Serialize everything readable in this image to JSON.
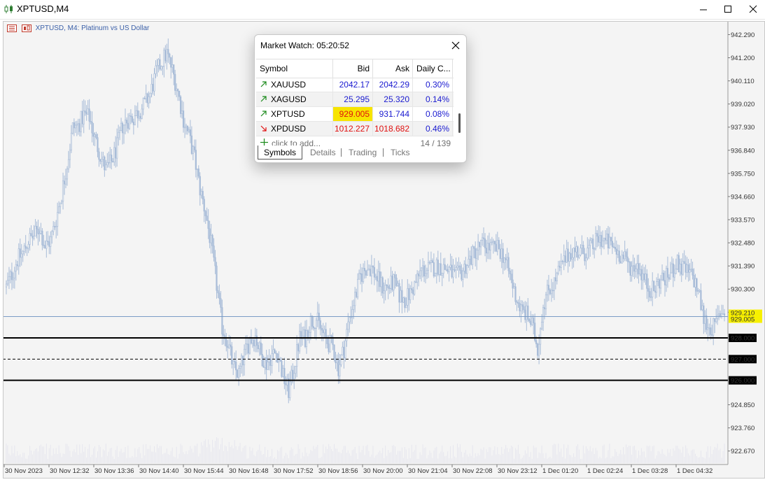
{
  "window": {
    "title": "XPTUSD,M4",
    "app_icon": "candlestick-chart-icon",
    "buttons": [
      "minimize-icon",
      "maximize-icon",
      "close-icon"
    ]
  },
  "chart": {
    "header": "XPTUSD, M4:  Platinum vs US Dollar",
    "price_ticks": [
      "942.290",
      "941.200",
      "940.110",
      "939.020",
      "937.930",
      "936.840",
      "935.750",
      "934.660",
      "933.570",
      "932.480",
      "931.390",
      "930.300",
      "929.210",
      "928.000",
      "927.000",
      "926.000",
      "924.850",
      "923.760",
      "922.670"
    ],
    "time_ticks": [
      "30 Nov 2023",
      "30 Nov 12:32",
      "30 Nov 13:36",
      "30 Nov 14:40",
      "30 Nov 15:44",
      "30 Nov 16:48",
      "30 Nov 17:52",
      "30 Nov 18:56",
      "30 Nov 20:00",
      "30 Nov 21:04",
      "30 Nov 22:08",
      "30 Nov 23:12",
      "1 Dec 01:20",
      "1 Dec 02:24",
      "1 Dec 03:28",
      "1 Dec 04:32"
    ],
    "current_price_label": "929.005",
    "level_lines": [
      {
        "price": "928.000",
        "style": "solid"
      },
      {
        "price": "927.000",
        "style": "dashed"
      },
      {
        "price": "926.000",
        "style": "solid"
      }
    ],
    "colors": {
      "background": "#f4f4f4",
      "candles": "#a8bcd8",
      "bid_line": "#7a9cc6",
      "bid_label_bg": "#f7f000",
      "levels": "#000000"
    }
  },
  "chart_data": {
    "type": "candlestick",
    "symbol": "XPTUSD",
    "timeframe": "M4",
    "ylim": [
      922.0,
      943.0
    ],
    "close_profile": [
      [
        0,
        930.4
      ],
      [
        4,
        931.0
      ],
      [
        8,
        931.7
      ],
      [
        12,
        932.0
      ],
      [
        16,
        932.6
      ],
      [
        20,
        932.8
      ],
      [
        24,
        933.2
      ],
      [
        28,
        932.3
      ],
      [
        32,
        932.6
      ],
      [
        36,
        933.6
      ],
      [
        40,
        934.8
      ],
      [
        44,
        936.2
      ],
      [
        48,
        937.9
      ],
      [
        52,
        938.0
      ],
      [
        56,
        938.5
      ],
      [
        60,
        938.4
      ],
      [
        64,
        937.4
      ],
      [
        68,
        936.6
      ],
      [
        72,
        935.9
      ],
      [
        76,
        936.3
      ],
      [
        80,
        937.0
      ],
      [
        84,
        938.0
      ],
      [
        88,
        938.3
      ],
      [
        92,
        938.4
      ],
      [
        96,
        938.7
      ],
      [
        100,
        939.0
      ],
      [
        104,
        939.5
      ],
      [
        108,
        940.4
      ],
      [
        112,
        941.0
      ],
      [
        116,
        941.4
      ],
      [
        120,
        940.6
      ],
      [
        124,
        939.6
      ],
      [
        128,
        938.3
      ],
      [
        132,
        937.5
      ],
      [
        136,
        936.5
      ],
      [
        140,
        935.0
      ],
      [
        144,
        933.9
      ],
      [
        148,
        932.4
      ],
      [
        152,
        930.5
      ],
      [
        156,
        928.5
      ],
      [
        160,
        927.8
      ],
      [
        164,
        926.6
      ],
      [
        168,
        926.3
      ],
      [
        172,
        927.2
      ],
      [
        176,
        927.9
      ],
      [
        180,
        928.1
      ],
      [
        184,
        927.2
      ],
      [
        188,
        926.8
      ],
      [
        192,
        927.2
      ],
      [
        196,
        927.3
      ],
      [
        200,
        926.2
      ],
      [
        204,
        925.5
      ],
      [
        208,
        926.6
      ],
      [
        212,
        928.0
      ],
      [
        216,
        928.0
      ],
      [
        220,
        928.8
      ],
      [
        224,
        928.9
      ],
      [
        228,
        928.3
      ],
      [
        232,
        927.8
      ],
      [
        236,
        927.6
      ],
      [
        240,
        926.6
      ],
      [
        244,
        927.5
      ],
      [
        248,
        929.0
      ],
      [
        252,
        929.9
      ],
      [
        256,
        930.9
      ],
      [
        260,
        931.3
      ],
      [
        264,
        931.3
      ],
      [
        268,
        930.8
      ],
      [
        272,
        930.4
      ],
      [
        276,
        930.4
      ],
      [
        280,
        930.6
      ],
      [
        284,
        930.0
      ],
      [
        288,
        929.8
      ],
      [
        292,
        930.1
      ],
      [
        296,
        930.6
      ],
      [
        300,
        931.2
      ],
      [
        304,
        931.2
      ],
      [
        308,
        931.3
      ],
      [
        312,
        931.4
      ],
      [
        316,
        931.3
      ],
      [
        320,
        931.2
      ],
      [
        324,
        930.9
      ],
      [
        328,
        931.0
      ],
      [
        332,
        931.4
      ],
      [
        336,
        931.8
      ],
      [
        340,
        932.2
      ],
      [
        344,
        932.4
      ],
      [
        348,
        932.3
      ],
      [
        352,
        932.2
      ],
      [
        356,
        932.2
      ],
      [
        360,
        931.8
      ],
      [
        364,
        930.9
      ],
      [
        368,
        930.0
      ],
      [
        372,
        929.3
      ],
      [
        376,
        929.1
      ],
      [
        380,
        928.6
      ],
      [
        384,
        927.5
      ],
      [
        388,
        929.6
      ],
      [
        392,
        930.3
      ],
      [
        396,
        930.6
      ],
      [
        400,
        931.2
      ],
      [
        404,
        931.7
      ],
      [
        408,
        932.1
      ],
      [
        412,
        932.1
      ],
      [
        416,
        932.0
      ],
      [
        420,
        932.1
      ],
      [
        424,
        932.3
      ],
      [
        428,
        932.7
      ],
      [
        432,
        932.6
      ],
      [
        436,
        932.4
      ],
      [
        440,
        932.2
      ],
      [
        444,
        931.9
      ],
      [
        448,
        931.6
      ],
      [
        452,
        931.3
      ],
      [
        456,
        931.5
      ],
      [
        460,
        930.9
      ],
      [
        464,
        930.4
      ],
      [
        468,
        930.2
      ],
      [
        472,
        930.7
      ],
      [
        476,
        930.8
      ],
      [
        480,
        931.0
      ],
      [
        484,
        931.5
      ],
      [
        488,
        931.3
      ],
      [
        492,
        931.1
      ],
      [
        496,
        930.9
      ],
      [
        500,
        930.2
      ],
      [
        504,
        928.9
      ],
      [
        508,
        928.5
      ],
      [
        512,
        928.5
      ],
      [
        516,
        929.2
      ],
      [
        520,
        929.3
      ]
    ],
    "current_price": 929.005,
    "levels": [
      928.0,
      927.0,
      926.0
    ]
  },
  "market_watch": {
    "title": "Market Watch: 05:20:52",
    "columns": [
      "Symbol",
      "Bid",
      "Ask",
      "Daily C..."
    ],
    "rows": [
      {
        "symbol": "XAUUSD",
        "direction": "up",
        "bid": "2042.17",
        "ask": "2042.29",
        "daily": "0.30%"
      },
      {
        "symbol": "XAGUSD",
        "direction": "up",
        "bid": "25.295",
        "ask": "25.320",
        "daily": "0.14%"
      },
      {
        "symbol": "XPTUSD",
        "direction": "up",
        "bid": "929.005",
        "ask": "931.744",
        "daily": "0.08%",
        "bid_highlight": true
      },
      {
        "symbol": "XPDUSD",
        "direction": "down",
        "bid": "1012.227",
        "ask": "1018.682",
        "daily": "0.46%"
      }
    ],
    "add_placeholder": "click to add...",
    "count": "14 / 139",
    "tabs": [
      "Symbols",
      "Details",
      "Trading",
      "Ticks"
    ],
    "active_tab": "Symbols"
  }
}
